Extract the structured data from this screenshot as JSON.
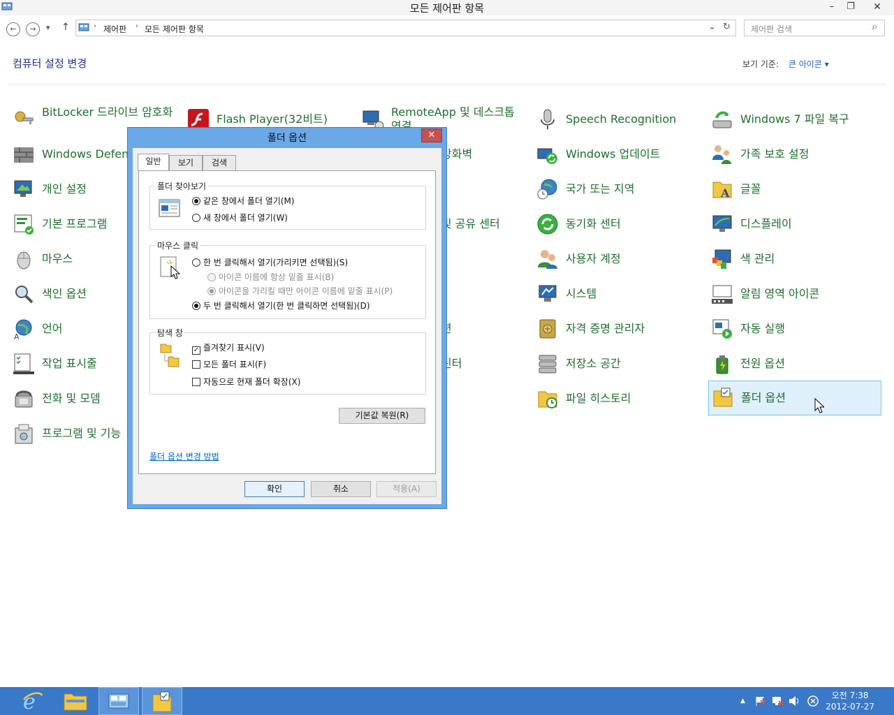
{
  "window": {
    "title": "모든 제어판 항목",
    "minimize": "–",
    "restore": "❐",
    "close": "✕"
  },
  "nav": {
    "back": "←",
    "forward": "→",
    "recent": "▾",
    "up": "↑",
    "breadcrumb": [
      "제어판",
      "모든 제어판 항목"
    ],
    "sep": "›",
    "address_dropdown": "⌄",
    "refresh": "↻",
    "search_placeholder": "제어판 검색",
    "search_icon": "⌕"
  },
  "cp": {
    "heading": "컴퓨터 설정 변경",
    "view_by_label": "보기 기준:",
    "view_by_value": "큰 아이콘 ▾",
    "items": [
      [
        "BitLocker 드라이브 암호화",
        "Windows Defender",
        "개인 설정",
        "기본 프로그램",
        "마우스",
        "색인 옵션",
        "언어",
        "작업 표시줄",
        "전화 및 모뎀",
        "프로그램 및 기능"
      ],
      [
        "Flash Player(32비트)"
      ],
      [
        "RemoteApp 및 데스크톱 연결",
        "방화벽",
        "및 공유 센터",
        "션",
        "린터"
      ],
      [
        "Speech Recognition",
        "Windows 업데이트",
        "국가 또는 지역",
        "동기화 센터",
        "사용자 계정",
        "시스템",
        "자격 증명 관리자",
        "저장소 공간",
        "파일 히스토리"
      ],
      [
        "Windows 7 파일 복구",
        "가족 보호 설정",
        "글꼴",
        "디스플레이",
        "색 관리",
        "알림 영역 아이콘",
        "자동 실행",
        "전원 옵션",
        "폴더 옵션"
      ]
    ]
  },
  "dialog": {
    "title": "폴더 옵션",
    "close": "✕",
    "tabs": [
      "일반",
      "보기",
      "검색"
    ],
    "browse": {
      "title": "폴더 찾아보기",
      "same_window": "같은 창에서 폴더 열기(M)",
      "new_window": "새 창에서 폴더 열기(W)"
    },
    "click": {
      "title": "마우스 클릭",
      "single": "한 번 클릭해서 열기(가리키면 선택됨)(S)",
      "underline_always": "아이콘 이름에 항상 밑줄 표시(B)",
      "underline_hover": "아이콘을 가리킬 때만 아이콘 이름에 밑줄 표시(P)",
      "double": "두 번 클릭해서 열기(한 번 클릭하면 선택됨)(D)"
    },
    "nav_pane": {
      "title": "탐색 창",
      "favorites": "즐겨찾기 표시(V)",
      "all_folders": "모든 폴더 표시(F)",
      "auto_expand": "자동으로 현재 폴더 확장(X)",
      "check": "✓"
    },
    "restore_defaults": "기본값 복원(R)",
    "help_link": "폴더 옵션 변경 방법",
    "ok": "확인",
    "cancel": "취소",
    "apply": "적용(A)"
  },
  "taskbar": {
    "clock_time": "오전 7:38",
    "clock_date": "2012-07-27",
    "tray_up": "▲"
  }
}
